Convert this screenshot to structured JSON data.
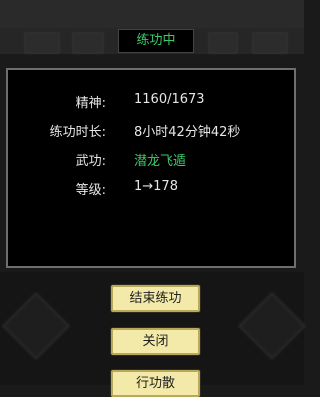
{
  "header": {
    "faded_text": "",
    "tabs": [
      "",
      "",
      "",
      "",
      ""
    ],
    "active_tab": "练功中"
  },
  "dialog": {
    "rows": [
      {
        "label": "精神:",
        "value": "1160/1673"
      },
      {
        "label": "练功时长:",
        "value": "8小时42分钟42秒"
      },
      {
        "label": "武功:",
        "value": "潜龙飞遁"
      },
      {
        "label": "等级:",
        "value": "1→178"
      }
    ],
    "value_accent_color": "#3cc96a"
  },
  "buttons": {
    "end_training": "结束练功",
    "close": "关闭",
    "third": "行功散"
  },
  "side": {
    "left_label": "",
    "right_label": ""
  }
}
